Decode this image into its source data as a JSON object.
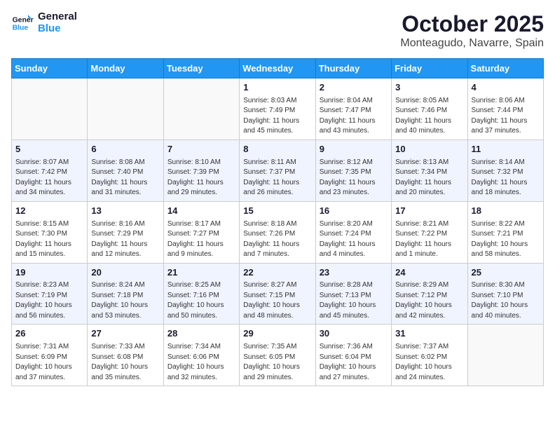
{
  "logo": {
    "line1": "General",
    "line2": "Blue"
  },
  "title": "October 2025",
  "subtitle": "Monteagudo, Navarre, Spain",
  "days_of_week": [
    "Sunday",
    "Monday",
    "Tuesday",
    "Wednesday",
    "Thursday",
    "Friday",
    "Saturday"
  ],
  "weeks": [
    [
      {
        "day": "",
        "info": ""
      },
      {
        "day": "",
        "info": ""
      },
      {
        "day": "",
        "info": ""
      },
      {
        "day": "1",
        "info": "Sunrise: 8:03 AM\nSunset: 7:49 PM\nDaylight: 11 hours\nand 45 minutes."
      },
      {
        "day": "2",
        "info": "Sunrise: 8:04 AM\nSunset: 7:47 PM\nDaylight: 11 hours\nand 43 minutes."
      },
      {
        "day": "3",
        "info": "Sunrise: 8:05 AM\nSunset: 7:46 PM\nDaylight: 11 hours\nand 40 minutes."
      },
      {
        "day": "4",
        "info": "Sunrise: 8:06 AM\nSunset: 7:44 PM\nDaylight: 11 hours\nand 37 minutes."
      }
    ],
    [
      {
        "day": "5",
        "info": "Sunrise: 8:07 AM\nSunset: 7:42 PM\nDaylight: 11 hours\nand 34 minutes."
      },
      {
        "day": "6",
        "info": "Sunrise: 8:08 AM\nSunset: 7:40 PM\nDaylight: 11 hours\nand 31 minutes."
      },
      {
        "day": "7",
        "info": "Sunrise: 8:10 AM\nSunset: 7:39 PM\nDaylight: 11 hours\nand 29 minutes."
      },
      {
        "day": "8",
        "info": "Sunrise: 8:11 AM\nSunset: 7:37 PM\nDaylight: 11 hours\nand 26 minutes."
      },
      {
        "day": "9",
        "info": "Sunrise: 8:12 AM\nSunset: 7:35 PM\nDaylight: 11 hours\nand 23 minutes."
      },
      {
        "day": "10",
        "info": "Sunrise: 8:13 AM\nSunset: 7:34 PM\nDaylight: 11 hours\nand 20 minutes."
      },
      {
        "day": "11",
        "info": "Sunrise: 8:14 AM\nSunset: 7:32 PM\nDaylight: 11 hours\nand 18 minutes."
      }
    ],
    [
      {
        "day": "12",
        "info": "Sunrise: 8:15 AM\nSunset: 7:30 PM\nDaylight: 11 hours\nand 15 minutes."
      },
      {
        "day": "13",
        "info": "Sunrise: 8:16 AM\nSunset: 7:29 PM\nDaylight: 11 hours\nand 12 minutes."
      },
      {
        "day": "14",
        "info": "Sunrise: 8:17 AM\nSunset: 7:27 PM\nDaylight: 11 hours\nand 9 minutes."
      },
      {
        "day": "15",
        "info": "Sunrise: 8:18 AM\nSunset: 7:26 PM\nDaylight: 11 hours\nand 7 minutes."
      },
      {
        "day": "16",
        "info": "Sunrise: 8:20 AM\nSunset: 7:24 PM\nDaylight: 11 hours\nand 4 minutes."
      },
      {
        "day": "17",
        "info": "Sunrise: 8:21 AM\nSunset: 7:22 PM\nDaylight: 11 hours\nand 1 minute."
      },
      {
        "day": "18",
        "info": "Sunrise: 8:22 AM\nSunset: 7:21 PM\nDaylight: 10 hours\nand 58 minutes."
      }
    ],
    [
      {
        "day": "19",
        "info": "Sunrise: 8:23 AM\nSunset: 7:19 PM\nDaylight: 10 hours\nand 56 minutes."
      },
      {
        "day": "20",
        "info": "Sunrise: 8:24 AM\nSunset: 7:18 PM\nDaylight: 10 hours\nand 53 minutes."
      },
      {
        "day": "21",
        "info": "Sunrise: 8:25 AM\nSunset: 7:16 PM\nDaylight: 10 hours\nand 50 minutes."
      },
      {
        "day": "22",
        "info": "Sunrise: 8:27 AM\nSunset: 7:15 PM\nDaylight: 10 hours\nand 48 minutes."
      },
      {
        "day": "23",
        "info": "Sunrise: 8:28 AM\nSunset: 7:13 PM\nDaylight: 10 hours\nand 45 minutes."
      },
      {
        "day": "24",
        "info": "Sunrise: 8:29 AM\nSunset: 7:12 PM\nDaylight: 10 hours\nand 42 minutes."
      },
      {
        "day": "25",
        "info": "Sunrise: 8:30 AM\nSunset: 7:10 PM\nDaylight: 10 hours\nand 40 minutes."
      }
    ],
    [
      {
        "day": "26",
        "info": "Sunrise: 7:31 AM\nSunset: 6:09 PM\nDaylight: 10 hours\nand 37 minutes."
      },
      {
        "day": "27",
        "info": "Sunrise: 7:33 AM\nSunset: 6:08 PM\nDaylight: 10 hours\nand 35 minutes."
      },
      {
        "day": "28",
        "info": "Sunrise: 7:34 AM\nSunset: 6:06 PM\nDaylight: 10 hours\nand 32 minutes."
      },
      {
        "day": "29",
        "info": "Sunrise: 7:35 AM\nSunset: 6:05 PM\nDaylight: 10 hours\nand 29 minutes."
      },
      {
        "day": "30",
        "info": "Sunrise: 7:36 AM\nSunset: 6:04 PM\nDaylight: 10 hours\nand 27 minutes."
      },
      {
        "day": "31",
        "info": "Sunrise: 7:37 AM\nSunset: 6:02 PM\nDaylight: 10 hours\nand 24 minutes."
      },
      {
        "day": "",
        "info": ""
      }
    ]
  ]
}
